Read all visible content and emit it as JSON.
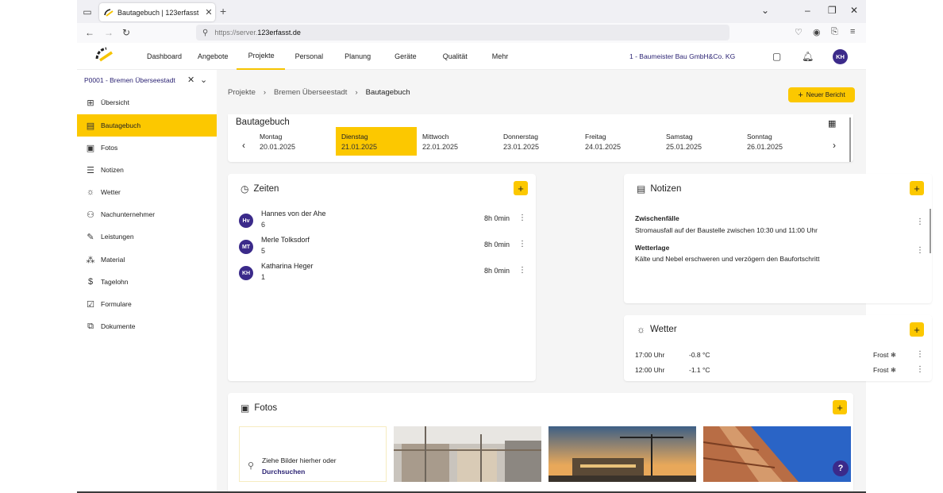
{
  "browser": {
    "tab_title": "Bautagebuch | 123erfasst",
    "url_prefix": "https://server.",
    "url_domain": "123erfasst.de"
  },
  "header": {
    "nav": [
      "Dashboard",
      "Angebote",
      "Projekte",
      "Personal",
      "Planung",
      "Geräte",
      "Qualität",
      "Mehr"
    ],
    "active_nav": "Projekte",
    "company": "1 - Baumeister Bau GmbH&Co. KG",
    "avatar": "KH"
  },
  "sidebar": {
    "project": "P0001 - Bremen Überseestadt",
    "items": [
      {
        "label": "Übersicht",
        "icon": "grid-icon"
      },
      {
        "label": "Bautagebuch",
        "icon": "book-icon"
      },
      {
        "label": "Fotos",
        "icon": "photo-icon"
      },
      {
        "label": "Notizen",
        "icon": "notes-icon"
      },
      {
        "label": "Wetter",
        "icon": "sun-icon"
      },
      {
        "label": "Nachunternehmer",
        "icon": "group-icon"
      },
      {
        "label": "Leistungen",
        "icon": "wrench-icon"
      },
      {
        "label": "Material",
        "icon": "material-icon"
      },
      {
        "label": "Tagelohn",
        "icon": "dollar-icon"
      },
      {
        "label": "Formulare",
        "icon": "form-icon"
      },
      {
        "label": "Dokumente",
        "icon": "documents-icon"
      }
    ],
    "active": "Bautagebuch"
  },
  "breadcrumb": [
    "Projekte",
    "Bremen Überseestadt",
    "Bautagebuch"
  ],
  "new_report_label": "Neuer Bericht",
  "diary": {
    "title": "Bautagebuch",
    "days": [
      {
        "name": "Montag",
        "date": "20.01.2025"
      },
      {
        "name": "Dienstag",
        "date": "21.01.2025"
      },
      {
        "name": "Mittwoch",
        "date": "22.01.2025"
      },
      {
        "name": "Donnerstag",
        "date": "23.01.2025"
      },
      {
        "name": "Freitag",
        "date": "24.01.2025"
      },
      {
        "name": "Samstag",
        "date": "25.01.2025"
      },
      {
        "name": "Sonntag",
        "date": "26.01.2025"
      }
    ],
    "active_day": "Dienstag"
  },
  "times": {
    "title": "Zeiten",
    "entries": [
      {
        "initials": "Hv",
        "name": "Hannes von der Ahe",
        "number": "6",
        "hours": "8h 0min"
      },
      {
        "initials": "MT",
        "name": "Merle Tolksdorf",
        "number": "5",
        "hours": "8h 0min"
      },
      {
        "initials": "KH",
        "name": "Katharina Heger",
        "number": "1",
        "hours": "8h 0min"
      }
    ]
  },
  "notes": {
    "title": "Notizen",
    "entries": [
      {
        "title": "Zwischenfälle",
        "text": "Stromausfall auf der Baustelle zwischen 10:30 und 11:00 Uhr"
      },
      {
        "title": "Wetterlage",
        "text": "Kälte und Nebel erschweren und verzögern den Baufortschritt"
      }
    ]
  },
  "weather": {
    "title": "Wetter",
    "entries": [
      {
        "time": "17:00 Uhr",
        "temp": "-0.8 °C",
        "condition": "Frost"
      },
      {
        "time": "12:00 Uhr",
        "temp": "-1.1 °C",
        "condition": "Frost"
      }
    ]
  },
  "photos": {
    "title": "Fotos",
    "drop_text": "Ziehe Bilder hierher oder",
    "browse_link": "Durchsuchen"
  },
  "colors": {
    "accent": "#fcc800",
    "brand": "#3b2a8a",
    "sidebar_active": "#fcc800"
  }
}
